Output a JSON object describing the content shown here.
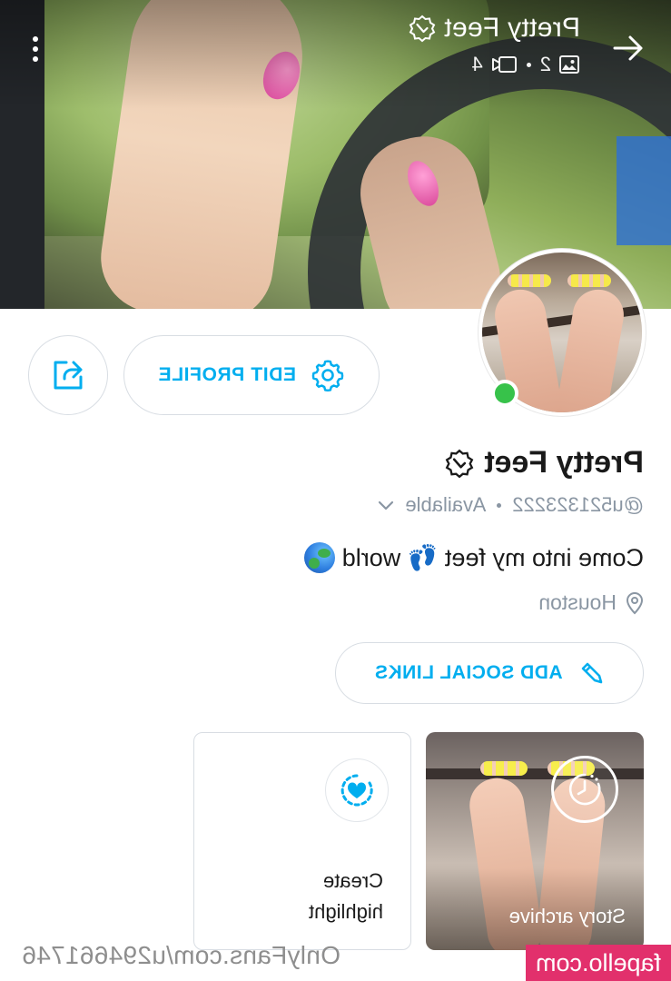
{
  "cover": {
    "title": "Pretty Feet",
    "photos_count": "2",
    "videos_count": "4"
  },
  "actions": {
    "edit_profile": "EDIT PROFILE",
    "add_social_links": "ADD SOCIAL LINKS"
  },
  "profile": {
    "name": "Pretty Feet",
    "handle": "@u521323222",
    "status": "Available",
    "bio": "Come into my feet 👣 world",
    "location": "Houston",
    "online": true
  },
  "highlights": [
    {
      "label": "Story archive",
      "icon": "clock-icon"
    },
    {
      "label_line1": "Create",
      "label_line2": "highlight",
      "icon": "heart-add-icon"
    }
  ],
  "footer": {
    "url": "OnlyFans.com/u294661746",
    "watermark": "fapello.com"
  },
  "colors": {
    "accent": "#00aeef",
    "online": "#37c24a",
    "muted": "#8a96a3",
    "watermark_bg": "#e2306c"
  }
}
